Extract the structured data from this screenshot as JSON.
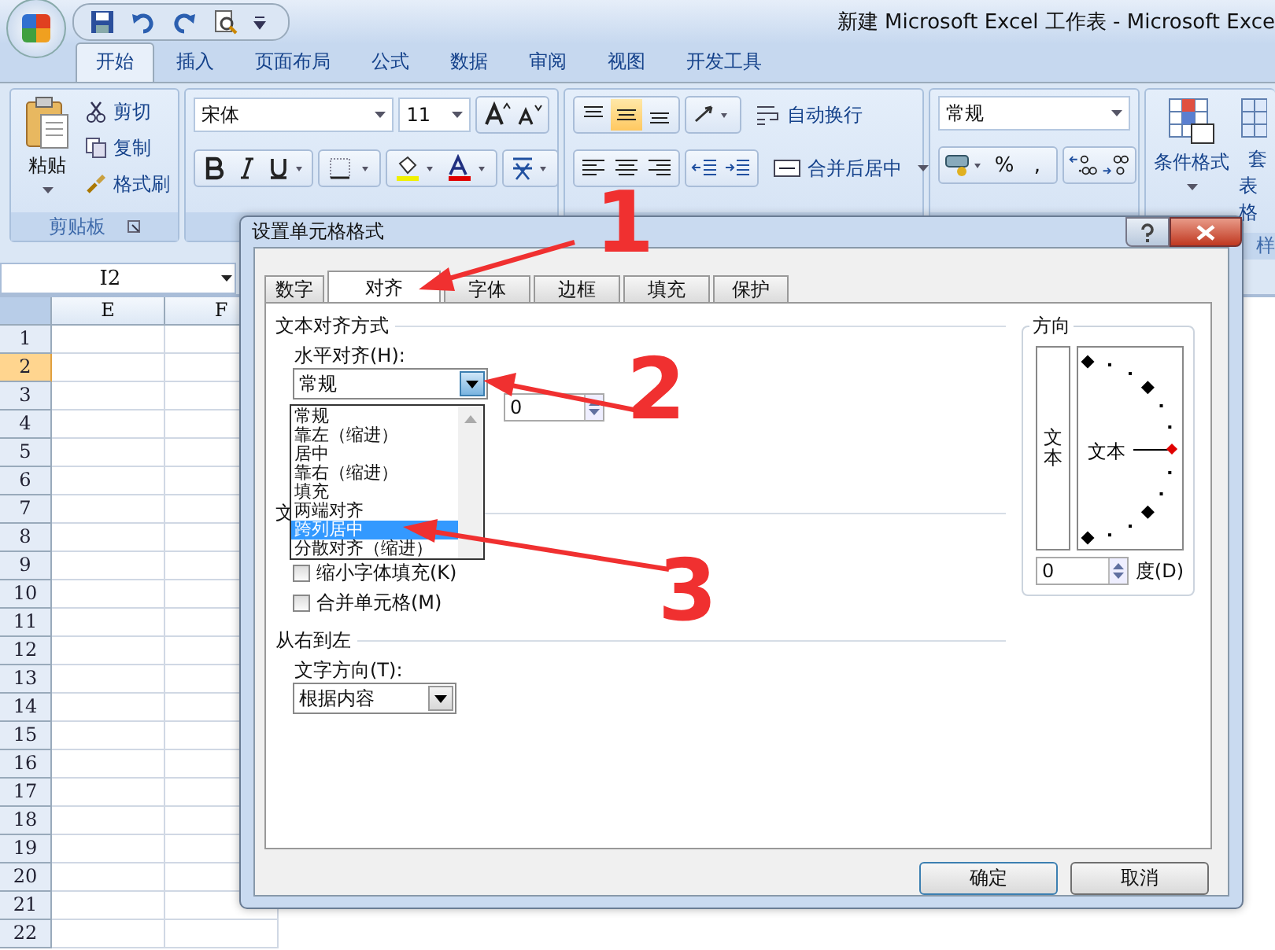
{
  "window": {
    "title": "新建 Microsoft Excel 工作表 - Microsoft Exce"
  },
  "ribbon_tabs": [
    {
      "label": "开始",
      "selected": true
    },
    {
      "label": "插入",
      "selected": false
    },
    {
      "label": "页面布局",
      "selected": false
    },
    {
      "label": "公式",
      "selected": false
    },
    {
      "label": "数据",
      "selected": false
    },
    {
      "label": "审阅",
      "selected": false
    },
    {
      "label": "视图",
      "selected": false
    },
    {
      "label": "开发工具",
      "selected": false
    }
  ],
  "clipboard": {
    "paste": "粘贴",
    "items": [
      "剪切",
      "复制",
      "格式刷"
    ],
    "group_label": "剪贴板"
  },
  "font": {
    "name": "宋体",
    "size": "11"
  },
  "alignment": {
    "vertical_buttons": [
      {
        "selected": false
      },
      {
        "selected": true
      },
      {
        "selected": false
      }
    ],
    "wrap": "自动换行",
    "merge": "合并后居中"
  },
  "number": {
    "format": "常规",
    "percent": "%",
    "comma": ","
  },
  "styles": {
    "conditional": "条件格式",
    "table_top": "套",
    "table_bottom": "表格",
    "group_label": "样"
  },
  "name_box": "I2",
  "sheet": {
    "columns": [
      "E",
      "F"
    ],
    "rows": [
      {
        "label": "1",
        "selected": false
      },
      {
        "label": "2",
        "selected": true
      },
      {
        "label": "3",
        "selected": false
      },
      {
        "label": "4",
        "selected": false
      },
      {
        "label": "5",
        "selected": false
      },
      {
        "label": "6",
        "selected": false
      },
      {
        "label": "7",
        "selected": false
      },
      {
        "label": "8",
        "selected": false
      },
      {
        "label": "9",
        "selected": false
      },
      {
        "label": "10",
        "selected": false
      },
      {
        "label": "11",
        "selected": false
      },
      {
        "label": "12",
        "selected": false
      },
      {
        "label": "13",
        "selected": false
      },
      {
        "label": "14",
        "selected": false
      },
      {
        "label": "15",
        "selected": false
      },
      {
        "label": "16",
        "selected": false
      },
      {
        "label": "17",
        "selected": false
      },
      {
        "label": "18",
        "selected": false
      },
      {
        "label": "19",
        "selected": false
      },
      {
        "label": "20",
        "selected": false
      },
      {
        "label": "21",
        "selected": false
      },
      {
        "label": "22",
        "selected": false
      }
    ]
  },
  "dialog": {
    "title": "设置单元格格式",
    "tabs": [
      {
        "label": "数字",
        "selected": false
      },
      {
        "label": "对齐",
        "selected": true
      },
      {
        "label": "字体",
        "selected": false
      },
      {
        "label": "边框",
        "selected": false
      },
      {
        "label": "填充",
        "selected": false
      },
      {
        "label": "保护",
        "selected": false
      }
    ],
    "text_alignment_label": "文本对齐方式",
    "horizontal_label": "水平对齐(H):",
    "horizontal_value": "常规",
    "indent_value": "0",
    "horizontal_options": [
      {
        "label": "常规",
        "selected": false
      },
      {
        "label": "靠左（缩进）",
        "selected": false
      },
      {
        "label": "居中",
        "selected": false
      },
      {
        "label": "靠右（缩进）",
        "selected": false
      },
      {
        "label": "填充",
        "selected": false
      },
      {
        "label": "两端对齐",
        "selected": false
      },
      {
        "label": "跨列居中",
        "selected": true
      },
      {
        "label": "分散对齐（缩进）",
        "selected": false
      }
    ],
    "text_control_label": "文",
    "checkboxes": [
      {
        "label": "缩小字体填充(K)",
        "checked": false
      },
      {
        "label": "合并单元格(M)",
        "checked": false
      }
    ],
    "rtl_label": "从右到左",
    "direction_label": "文字方向(T):",
    "direction_value": "根据内容",
    "orientation": {
      "label": "方向",
      "vertical_text": "文本",
      "dial_text": "文本",
      "degrees": "0",
      "degrees_label": "度(D)"
    },
    "buttons": [
      "确定",
      "取消"
    ]
  },
  "annotations": [
    {
      "label": "1"
    },
    {
      "label": "2"
    },
    {
      "label": "3"
    }
  ]
}
